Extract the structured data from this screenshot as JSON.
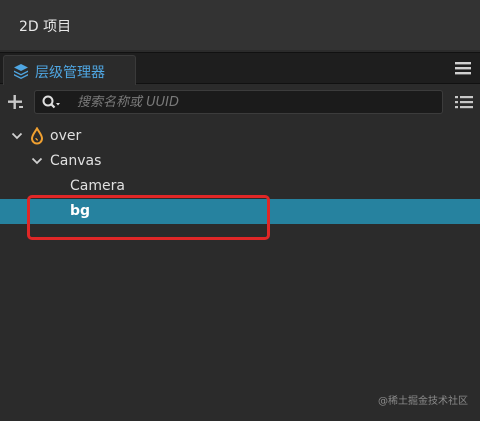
{
  "window": {
    "title": "2D 项目"
  },
  "panel": {
    "tab_label": "层级管理器",
    "tab_icon": "layers-icon",
    "menu_icon": "hamburger-menu-icon"
  },
  "toolbar": {
    "add_icon": "add-node-icon",
    "search_placeholder": "搜索名称或 UUID",
    "search_value": "",
    "list_icon": "list-view-icon"
  },
  "tree": {
    "nodes": [
      {
        "label": "over",
        "depth": 0,
        "expanded": true,
        "icon": "scene-drop-icon",
        "selected": false
      },
      {
        "label": "Canvas",
        "depth": 1,
        "expanded": true,
        "selected": false
      },
      {
        "label": "Camera",
        "depth": 2,
        "selected": false
      },
      {
        "label": "bg",
        "depth": 2,
        "selected": true
      }
    ]
  },
  "colors": {
    "accent": "#4fa6e2",
    "selection": "#26829f",
    "highlight_box": "#e02727",
    "scene_icon": "#f0a030"
  },
  "watermark": "@稀土掘金技术社区"
}
